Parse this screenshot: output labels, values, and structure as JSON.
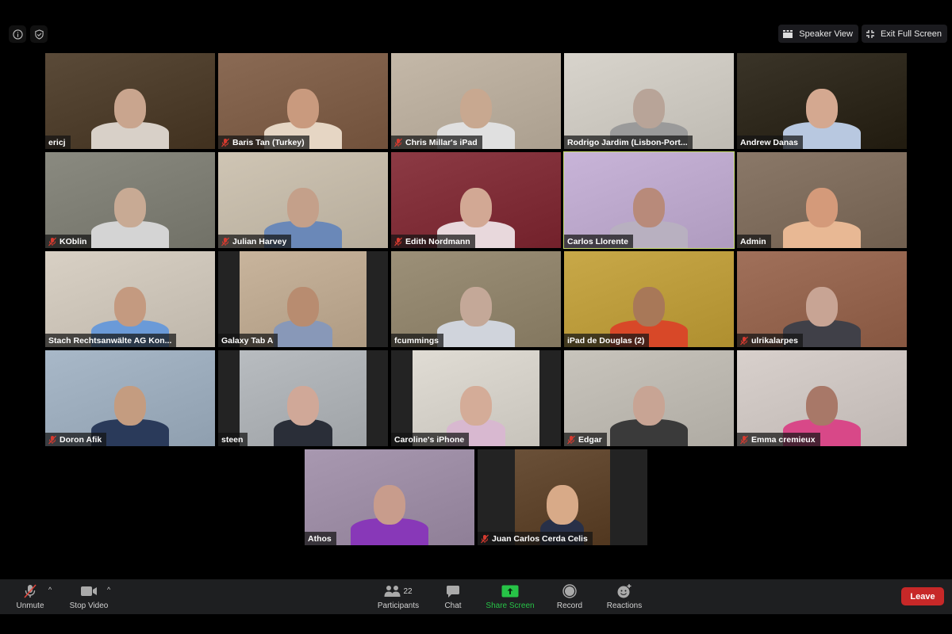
{
  "top_left": {
    "info_icon": "info-icon",
    "security_icon": "shield-check-icon"
  },
  "top_right": {
    "speaker_view_label": "Speaker View",
    "exit_fullscreen_label": "Exit Full Screen"
  },
  "participants": [
    {
      "name": "ericj",
      "muted": false,
      "bg": "#5a4a38",
      "skin": "#c9a58e",
      "shirt": "#d8d0c8"
    },
    {
      "name": "Baris Tan (Turkey)",
      "muted": true,
      "bg": "#8a6a54",
      "skin": "#c99a7e",
      "shirt": "#e6d6c4"
    },
    {
      "name": "Chris Millar's iPad",
      "muted": true,
      "bg": "#c4b8a8",
      "skin": "#c8a890",
      "shirt": "#e0e0e0"
    },
    {
      "name": "Rodrigo Jardim (Lisbon-Port...",
      "muted": false,
      "bg": "#d8d4cc",
      "skin": "#b8a498",
      "shirt": "#9a9a9a"
    },
    {
      "name": "Andrew Danas",
      "muted": false,
      "bg": "#3a3428",
      "skin": "#d4a890",
      "shirt": "#b8c8e0"
    },
    {
      "name": "KOblin",
      "muted": true,
      "bg": "#8a8a80",
      "skin": "#c8aa94",
      "shirt": "#d4d4d4"
    },
    {
      "name": "Julian Harvey",
      "muted": true,
      "bg": "#cfc5b4",
      "skin": "#c4a08a",
      "shirt": "#6a88b8"
    },
    {
      "name": "Edith Nordmann",
      "muted": true,
      "bg": "#8c3a44",
      "skin": "#d2a894",
      "shirt": "#e8d8dc"
    },
    {
      "name": "Carlos Llorente",
      "muted": false,
      "bg": "#c8b4d8",
      "skin": "#b88a7a",
      "shirt": "#b8b0c0"
    },
    {
      "name": "Admin",
      "muted": false,
      "bg": "#8a7868",
      "skin": "#d49a7a",
      "shirt": "#e8b894"
    },
    {
      "name": "Stach Rechtsanwälte AG Kon...",
      "muted": false,
      "bg": "#d8d0c4",
      "skin": "#c49a80",
      "shirt": "#6a9ad8"
    },
    {
      "name": "Galaxy Tab A",
      "muted": false,
      "bg": "#c8b49c",
      "skin": "#b88c70",
      "shirt": "#8898b8"
    },
    {
      "name": "fcummings",
      "muted": false,
      "bg": "#9c9078",
      "skin": "#c4a898",
      "shirt": "#d0d4dc"
    },
    {
      "name": "iPad de Douglas (2)",
      "muted": false,
      "bg": "#c8a848",
      "skin": "#a87858",
      "shirt": "#d84828"
    },
    {
      "name": "ulrikalarpes",
      "muted": true,
      "bg": "#a0705a",
      "skin": "#c8a494",
      "shirt": "#404048"
    },
    {
      "name": "Doron Afik",
      "muted": true,
      "bg": "#a8b8c8",
      "skin": "#c49c80",
      "shirt": "#2a3a5a"
    },
    {
      "name": "steen",
      "muted": false,
      "bg": "#b8bcc0",
      "skin": "#d0a898",
      "shirt": "#2a2e38"
    },
    {
      "name": "Caroline's iPhone",
      "muted": false,
      "bg": "#e0dcd4",
      "skin": "#d4ac98",
      "shirt": "#d8b8d0"
    },
    {
      "name": "Edgar",
      "muted": true,
      "bg": "#c8c4bc",
      "skin": "#c8a494",
      "shirt": "#3a3a3a"
    },
    {
      "name": "Emma cremieux",
      "muted": true,
      "bg": "#d8d0cc",
      "skin": "#a87868",
      "shirt": "#d84888"
    },
    {
      "name": "Athos",
      "muted": false,
      "bg": "#a898b0",
      "skin": "#c89c8c",
      "shirt": "#8838b8"
    },
    {
      "name": "Juan Carlos Cerda Celis",
      "muted": true,
      "bg": "#6a5038",
      "skin": "#d8aa88",
      "shirt": "#283048"
    }
  ],
  "active_speaker": "Carlos Llorente",
  "toolbar": {
    "unmute_label": "Unmute",
    "stop_video_label": "Stop Video",
    "participants_label": "Participants",
    "participants_count": "22",
    "chat_label": "Chat",
    "share_screen_label": "Share Screen",
    "record_label": "Record",
    "reactions_label": "Reactions",
    "leave_label": "Leave",
    "caret": "^"
  },
  "colors": {
    "accent_green": "#27c347",
    "leave_red": "#c72828",
    "active_border": "#c5da6a",
    "muted_red": "#d63a2f"
  }
}
